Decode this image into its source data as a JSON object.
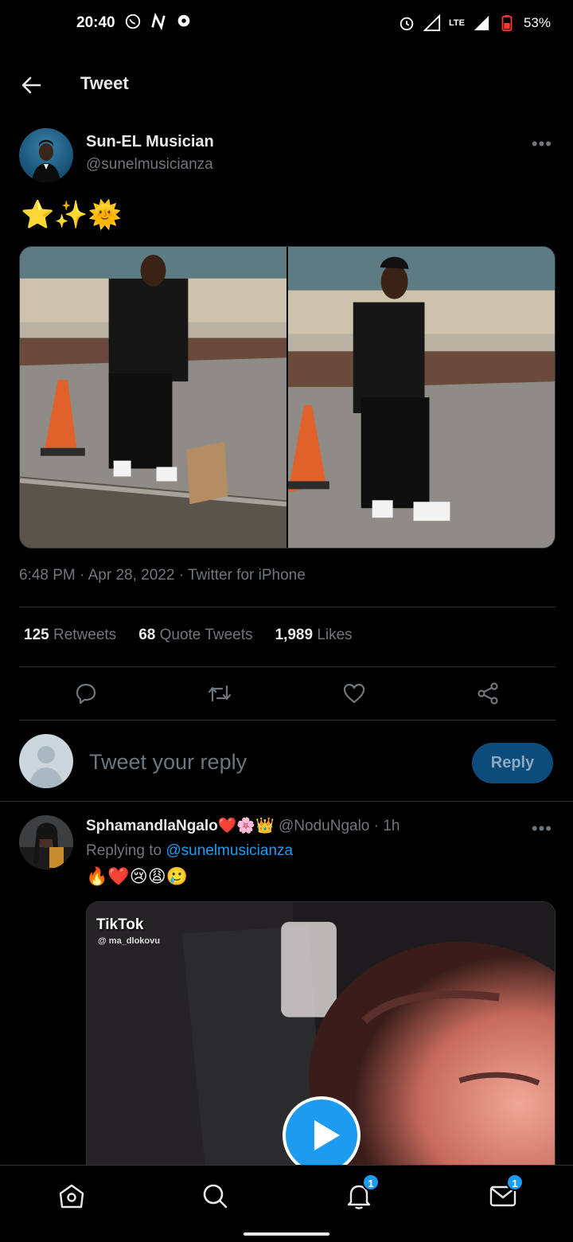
{
  "status_bar": {
    "time": "20:40",
    "left_icons": [
      "whatsapp-icon",
      "n-icon",
      "messenger-icon"
    ],
    "network": "LTE",
    "battery": "53%"
  },
  "header": {
    "title": "Tweet",
    "back_icon": "back-arrow-icon"
  },
  "tweet": {
    "author_name": "Sun-EL Musician",
    "author_handle": "@sunelmusicianza",
    "text": "⭐✨🌞",
    "timestamp": "6:48 PM · Apr 28, 2022 · Twitter for iPhone",
    "stats": [
      {
        "value": "125",
        "label": "Retweets"
      },
      {
        "value": "68",
        "label": "Quote Tweets"
      },
      {
        "value": "1,989",
        "label": "Likes"
      }
    ],
    "actions": [
      "reply-icon",
      "retweet-icon",
      "like-icon",
      "share-icon"
    ]
  },
  "composer": {
    "placeholder": "Tweet your reply",
    "button_label": "Reply"
  },
  "reply": {
    "author_name": "SphamandlaNgalo❤️🌸👑",
    "author_handle": "@NoduNgalo",
    "time": "· 1h",
    "replying_prefix": "Replying to",
    "replying_to": "@sunelmusicianza",
    "emojis": "🔥❤️😢😩🥲",
    "video": {
      "logo": "TikTok",
      "watermark_user": "@ ma_dlokovu"
    }
  },
  "bottom_nav": {
    "items": [
      "home-icon",
      "search-icon",
      "notifications-icon",
      "messages-icon"
    ],
    "notifications_badge": "1",
    "messages_badge": "1"
  },
  "colors": {
    "accent": "#1d9bf0",
    "background": "#000000",
    "muted": "#71767b",
    "text": "#e7e9ea"
  }
}
